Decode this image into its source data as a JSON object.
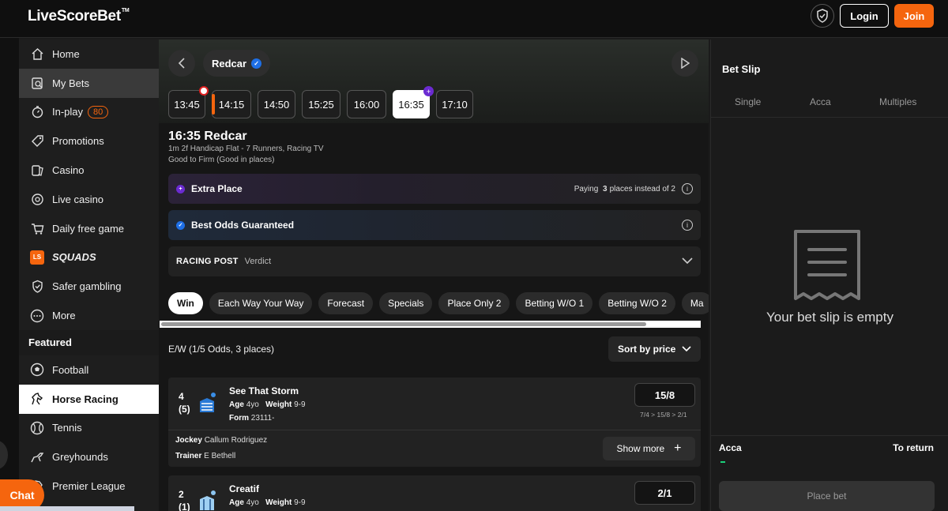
{
  "header": {
    "logo": "LiveScoreBet",
    "logo_tm": "TM",
    "login_label": "Login",
    "join_label": "Join"
  },
  "sidebar": {
    "items": [
      {
        "label": "Home",
        "icon": "home-icon"
      },
      {
        "label": "My Bets",
        "icon": "receipt-icon"
      },
      {
        "label": "In-play",
        "icon": "stopwatch-icon",
        "badge": "80"
      },
      {
        "label": "Promotions",
        "icon": "tag-icon"
      },
      {
        "label": "Casino",
        "icon": "cards-icon"
      },
      {
        "label": "Live casino",
        "icon": "chip-icon"
      },
      {
        "label": "Daily free game",
        "icon": "cart-icon"
      },
      {
        "label": "SQUADS",
        "icon": "ls-icon",
        "icon_text": "LS"
      },
      {
        "label": "Safer gambling",
        "icon": "shield-check-icon"
      },
      {
        "label": "More",
        "icon": "more-icon"
      }
    ],
    "featured_title": "Featured",
    "featured": [
      {
        "label": "Football",
        "icon": "football-icon"
      },
      {
        "label": "Horse Racing",
        "icon": "horse-icon"
      },
      {
        "label": "Tennis",
        "icon": "tennis-icon"
      },
      {
        "label": "Greyhounds",
        "icon": "greyhound-icon"
      },
      {
        "label": "Premier League",
        "icon": "lion-icon"
      }
    ]
  },
  "chat_label": "Chat",
  "race": {
    "venue": "Redcar",
    "times": [
      "13:45",
      "14:15",
      "14:50",
      "15:25",
      "16:00",
      "16:35",
      "17:10"
    ],
    "selected_time": "16:35",
    "title": "16:35 Redcar",
    "subtitle": "1m 2f Handicap Flat - 7 Runners, Racing TV",
    "going": "Good to Firm (Good in places)"
  },
  "promos": {
    "extra_place": {
      "label": "Extra Place",
      "right_pre": "Paying",
      "right_num": "3",
      "right_post": "places instead of 2"
    },
    "bog": {
      "label": "Best Odds Guaranteed"
    },
    "verdict": {
      "logo": "RACING POST",
      "label": "Verdict"
    }
  },
  "tabs": [
    "Win",
    "Each Way Your Way",
    "Forecast",
    "Specials",
    "Place Only 2",
    "Betting W/O 1",
    "Betting W/O 2",
    "Ma"
  ],
  "market": {
    "ew_terms": "E/W (1/5 Odds, 3 places)",
    "sort_label": "Sort by price"
  },
  "runners": [
    {
      "number": "4",
      "draw": "(5)",
      "name": "See That Storm",
      "age_label": "Age",
      "age": "4yo",
      "weight_label": "Weight",
      "weight": "9-9",
      "form_label": "Form",
      "form": "23111-",
      "odds": "15/8",
      "odds_history": "7/4 > 15/8 > 2/1",
      "jockey_label": "Jockey",
      "jockey": "Callum Rodriguez",
      "trainer_label": "Trainer",
      "trainer": "E Bethell",
      "show_more": "Show more"
    },
    {
      "number": "2",
      "draw": "(1)",
      "name": "Creatif",
      "age_label": "Age",
      "age": "4yo",
      "weight_label": "Weight",
      "weight": "9-9",
      "odds": "2/1"
    }
  ],
  "betslip": {
    "title": "Bet Slip",
    "tabs": [
      "Single",
      "Acca",
      "Multiples"
    ],
    "empty_text": "Your bet slip is empty",
    "acca_label": "Acca",
    "return_label": "To return",
    "place_bet_label": "Place bet"
  },
  "colors": {
    "brand_orange": "#f5650e",
    "extra_place_purple": "#6b2bd1",
    "bog_blue": "#1e6fe6",
    "acca_green": "#1bd17a"
  }
}
